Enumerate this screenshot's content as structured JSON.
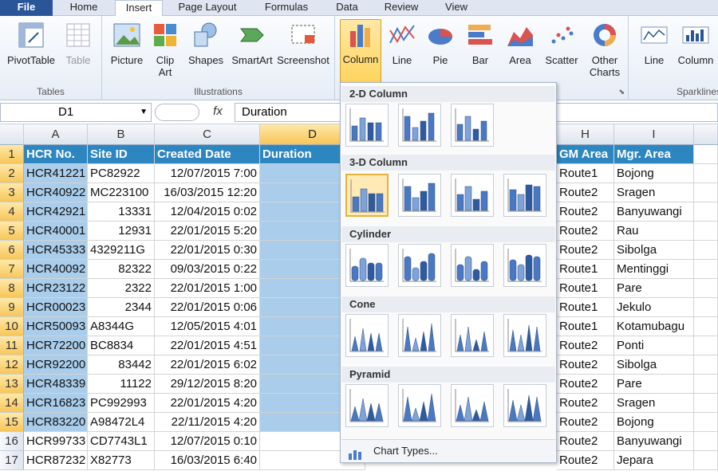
{
  "tabs": [
    "File",
    "Home",
    "Insert",
    "Page Layout",
    "Formulas",
    "Data",
    "Review",
    "View"
  ],
  "ribbon": {
    "groups": {
      "tables": "Tables",
      "illustrations": "Illustrations",
      "sparklines": "Sparklines"
    },
    "buttons": {
      "pivottable": "PivotTable",
      "table": "Table",
      "picture": "Picture",
      "clipart": "Clip\nArt",
      "shapes": "Shapes",
      "smartart": "SmartArt",
      "screenshot": "Screenshot",
      "column": "Column",
      "line": "Line",
      "pie": "Pie",
      "bar": "Bar",
      "area": "Area",
      "scatter": "Scatter",
      "other": "Other\nCharts",
      "spark_line": "Line",
      "spark_column": "Column"
    }
  },
  "formula_bar": {
    "name_box": "D1",
    "fx": "fx",
    "value": "Duration"
  },
  "columns": [
    "A",
    "B",
    "C",
    "D",
    "H",
    "I"
  ],
  "rows": [
    [
      "HCR No.",
      "Site ID",
      "Created Date",
      "Duration",
      "GM Area",
      "Mgr. Area"
    ],
    [
      "HCR41221",
      "PC82922",
      "12/07/2015 7:00",
      "",
      "Route1",
      "Bojong"
    ],
    [
      "HCR40922",
      "MC223100",
      "16/03/2015 12:20",
      "",
      "Route2",
      "Sragen"
    ],
    [
      "HCR42921",
      "13331",
      "12/04/2015 0:02",
      "",
      "Route2",
      "Banyuwangi"
    ],
    [
      "HCR40001",
      "12931",
      "22/01/2015 5:20",
      "",
      "Route2",
      "Rau"
    ],
    [
      "HCR45333",
      "4329211G",
      "22/01/2015 0:30",
      "",
      "Route2",
      "Sibolga"
    ],
    [
      "HCR40092",
      "82322",
      "09/03/2015 0:22",
      "",
      "Route1",
      "Mentinggi"
    ],
    [
      "HCR23122",
      "2322",
      "22/01/2015 1:00",
      "",
      "Route1",
      "Pare"
    ],
    [
      "HCR00023",
      "2344",
      "22/01/2015 0:06",
      "",
      "Route1",
      "Jekulo"
    ],
    [
      "HCR50093",
      "A8344G",
      "12/05/2015 4:01",
      "",
      "Route1",
      "Kotamubagu"
    ],
    [
      "HCR72200",
      "BC8834",
      "22/01/2015 4:51",
      "",
      "Route2",
      "Ponti"
    ],
    [
      "HCR92200",
      "83442",
      "22/01/2015 6:02",
      "",
      "Route2",
      "Sibolga"
    ],
    [
      "HCR48339",
      "11122",
      "29/12/2015 8:20",
      "",
      "Route2",
      "Pare"
    ],
    [
      "HCR16823",
      "PC992993",
      "22/01/2015 4:20",
      "",
      "Route2",
      "Sragen"
    ],
    [
      "HCR83220",
      "A98472L4",
      "22/11/2015 4:20",
      "",
      "Route2",
      "Bojong"
    ],
    [
      "HCR99733",
      "CD7743L1",
      "12/07/2015 0:10",
      "",
      "Route2",
      "Banyuwangi"
    ],
    [
      "HCR87232",
      "X82773",
      "16/03/2015 6:40",
      "",
      "Route2",
      "Jepara"
    ]
  ],
  "gallery": {
    "sections": [
      "2-D Column",
      "3-D Column",
      "Cylinder",
      "Cone",
      "Pyramid"
    ],
    "footer": "Chart Types..."
  }
}
